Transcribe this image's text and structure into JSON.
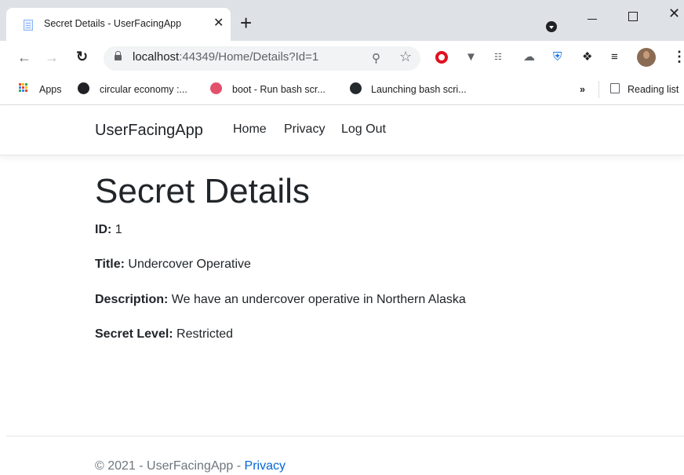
{
  "browser": {
    "tab_title": "Secret Details - UserFacingApp",
    "tab_close": "✕",
    "new_tab": "+",
    "url_host": "localhost",
    "url_rest": ":44349/Home/Details?Id=1",
    "minimize": "",
    "close": "✕",
    "bookmarks": [
      {
        "label": "Apps"
      },
      {
        "label": "circular economy :..."
      },
      {
        "label": "boot - Run bash scr..."
      },
      {
        "label": "Launching bash scri..."
      }
    ],
    "overflow": "»",
    "reading_list": "Reading list"
  },
  "nav": {
    "brand": "UserFacingApp",
    "links": [
      "Home",
      "Privacy",
      "Log Out"
    ]
  },
  "page": {
    "title": "Secret Details",
    "fields": [
      {
        "label": "ID:",
        "value": " 1"
      },
      {
        "label": "Title:",
        "value": " Undercover Operative"
      },
      {
        "label": "Description:",
        "value": " We have an undercover operative in Northern Alaska"
      },
      {
        "label": "Secret Level:",
        "value": " Restricted"
      }
    ]
  },
  "footer": {
    "text": "© 2021 - UserFacingApp - ",
    "link": "Privacy"
  },
  "colors": {
    "link": "#0366d6",
    "chrome": "#dee1e6"
  }
}
